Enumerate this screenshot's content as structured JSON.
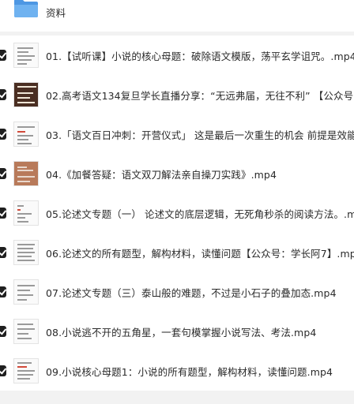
{
  "folder": {
    "name": "资料",
    "icon": "folder-icon",
    "color": "#5aa3e8"
  },
  "files": [
    {
      "name": "01.【试听课】小说的核心母题：破除语文模版，荡平玄学诅咒。.mp4",
      "thumb_style": "doc"
    },
    {
      "name": "02.高考语文134复旦学长直播分享：“无远弗届，无往不利” 【公众号：学长阿7】.mp4",
      "thumb_style": "dark"
    },
    {
      "name": "03.「语文百日冲刺：开营仪式」 这是最后一次重生的机会 前提是效能，3个月拿下语文.mp4",
      "thumb_style": "doc"
    },
    {
      "name": "04.《加餐答疑：语文双刀解法亲自操刀实践》.mp4",
      "thumb_style": "photo"
    },
    {
      "name": "05.论述文专题（一） 论述文的底层逻辑，无死角秒杀的阅读方法。.mp4",
      "thumb_style": "doc"
    },
    {
      "name": "06.论述文的所有题型，解构材料，读懂问题【公众号：学长阿7】.mp4",
      "thumb_style": "doc"
    },
    {
      "name": "07.论述文专题（三）泰山般的难题，不过是小石子的叠加态.mp4",
      "thumb_style": "doc"
    },
    {
      "name": "08.小说逃不开的五角星，一套句模掌握小说写法、考法.mp4",
      "thumb_style": "doc"
    },
    {
      "name": "09.小说核心母题1：小说的所有题型，解构材料，读懂问题.mp4",
      "thumb_style": "doc"
    }
  ]
}
